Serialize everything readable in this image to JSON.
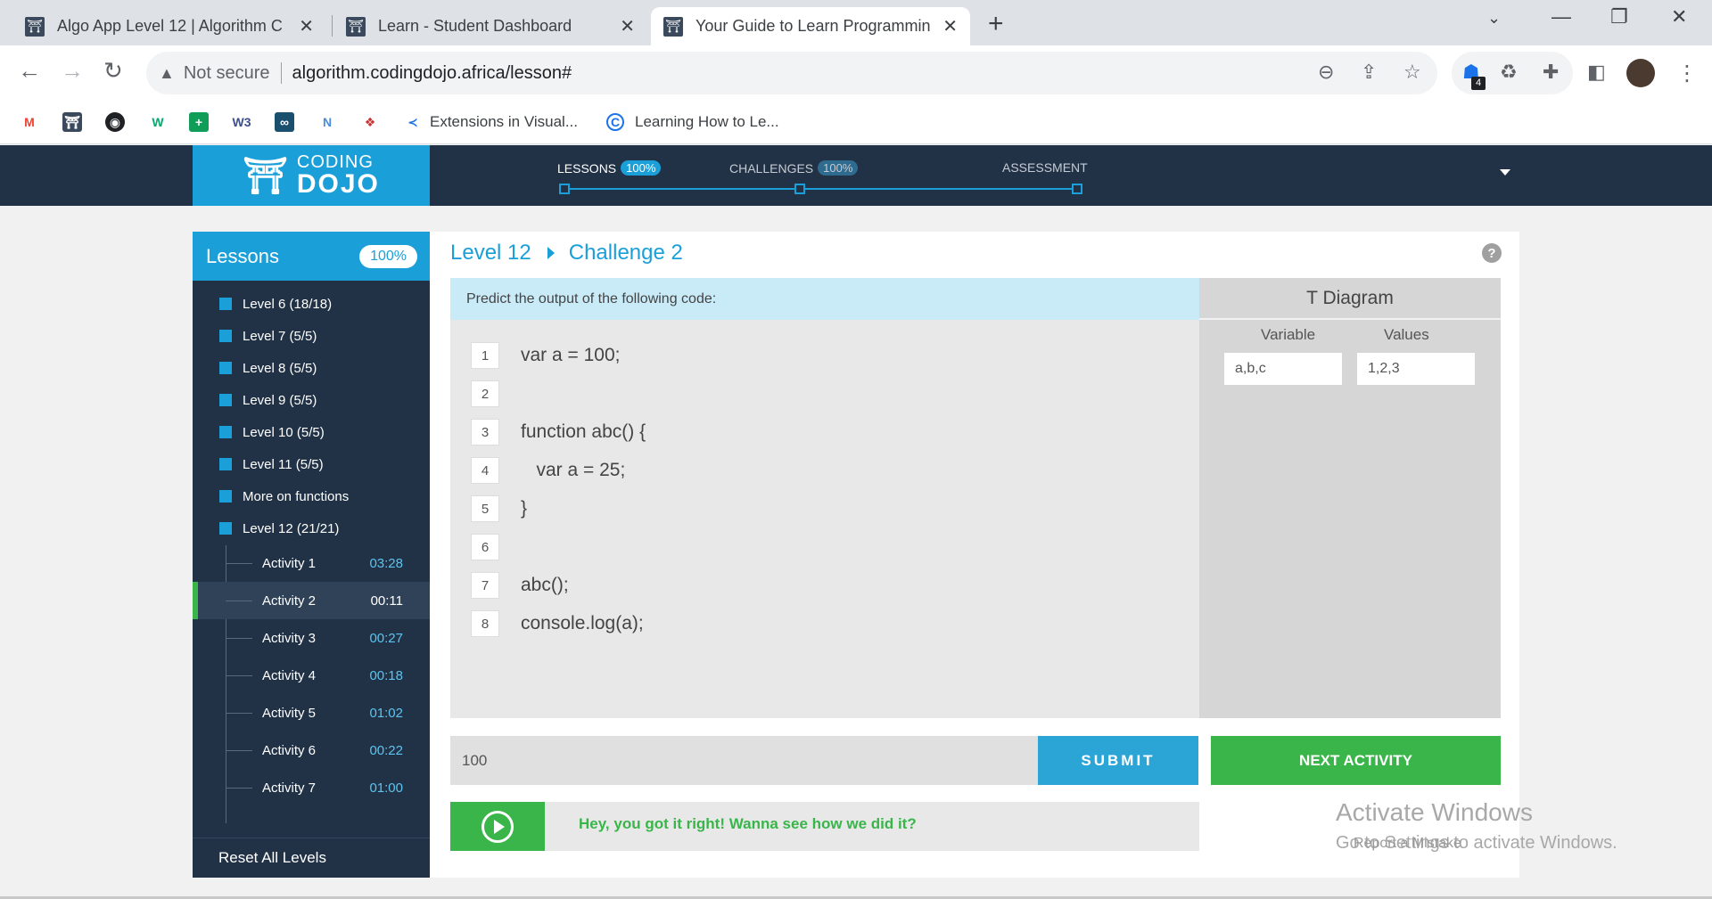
{
  "browser": {
    "tabs": [
      {
        "title": "Algo App Level 12 | Algorithm C",
        "active": false
      },
      {
        "title": "Learn - Student Dashboard",
        "active": false
      },
      {
        "title": "Your Guide to Learn Programmin",
        "active": true
      }
    ],
    "new_tab": "+",
    "security": "Not secure",
    "url": "algorithm.codingdojo.africa/lesson#",
    "extension_badge": "4",
    "bookmarks": [
      {
        "label": "Extensions in Visual..."
      },
      {
        "label": "Learning How to Le..."
      }
    ]
  },
  "header": {
    "logo_top": "CODING",
    "logo_bottom": "DOJO",
    "lessons_label": "LESSONS",
    "lessons_pct": "100%",
    "challenges_label": "CHALLENGES",
    "challenges_pct": "100%",
    "assessment_label": "ASSESSMENT"
  },
  "sidebar": {
    "title": "Lessons",
    "pct": "100%",
    "levels": [
      "Level 6 (18/18)",
      "Level 7 (5/5)",
      "Level 8 (5/5)",
      "Level 9 (5/5)",
      "Level 10 (5/5)",
      "Level 11 (5/5)",
      "More on functions",
      "Level 12 (21/21)"
    ],
    "activities": [
      {
        "name": "Activity 1",
        "time": "03:28"
      },
      {
        "name": "Activity 2",
        "time": "00:11"
      },
      {
        "name": "Activity 3",
        "time": "00:27"
      },
      {
        "name": "Activity 4",
        "time": "00:18"
      },
      {
        "name": "Activity 5",
        "time": "01:02"
      },
      {
        "name": "Activity 6",
        "time": "00:22"
      },
      {
        "name": "Activity 7",
        "time": "01:00"
      }
    ],
    "reset": "Reset All Levels"
  },
  "main": {
    "level": "Level 12",
    "challenge": "Challenge 2",
    "prompt": "Predict the output of the following code:",
    "code_lines": [
      {
        "n": "1",
        "code": "var a = 100;"
      },
      {
        "n": "2",
        "code": ""
      },
      {
        "n": "3",
        "code": "function abc() {"
      },
      {
        "n": "4",
        "code": "   var a = 25;"
      },
      {
        "n": "5",
        "code": "}"
      },
      {
        "n": "6",
        "code": ""
      },
      {
        "n": "7",
        "code": "abc();"
      },
      {
        "n": "8",
        "code": "console.log(a);"
      }
    ],
    "t_diagram": {
      "title": "T Diagram",
      "variable_label": "Variable",
      "values_label": "Values",
      "variable_value": "a,b,c",
      "values_value": "1,2,3"
    },
    "answer": "100",
    "submit": "SUBMIT",
    "next": "NEXT ACTIVITY",
    "feedback": "Hey, you got it right! Wanna see how we did it?"
  },
  "overlay": {
    "activate_title": "Activate Windows",
    "activate_sub": "Go to Settings to activate Windows.",
    "report": "Report a Mistake"
  }
}
